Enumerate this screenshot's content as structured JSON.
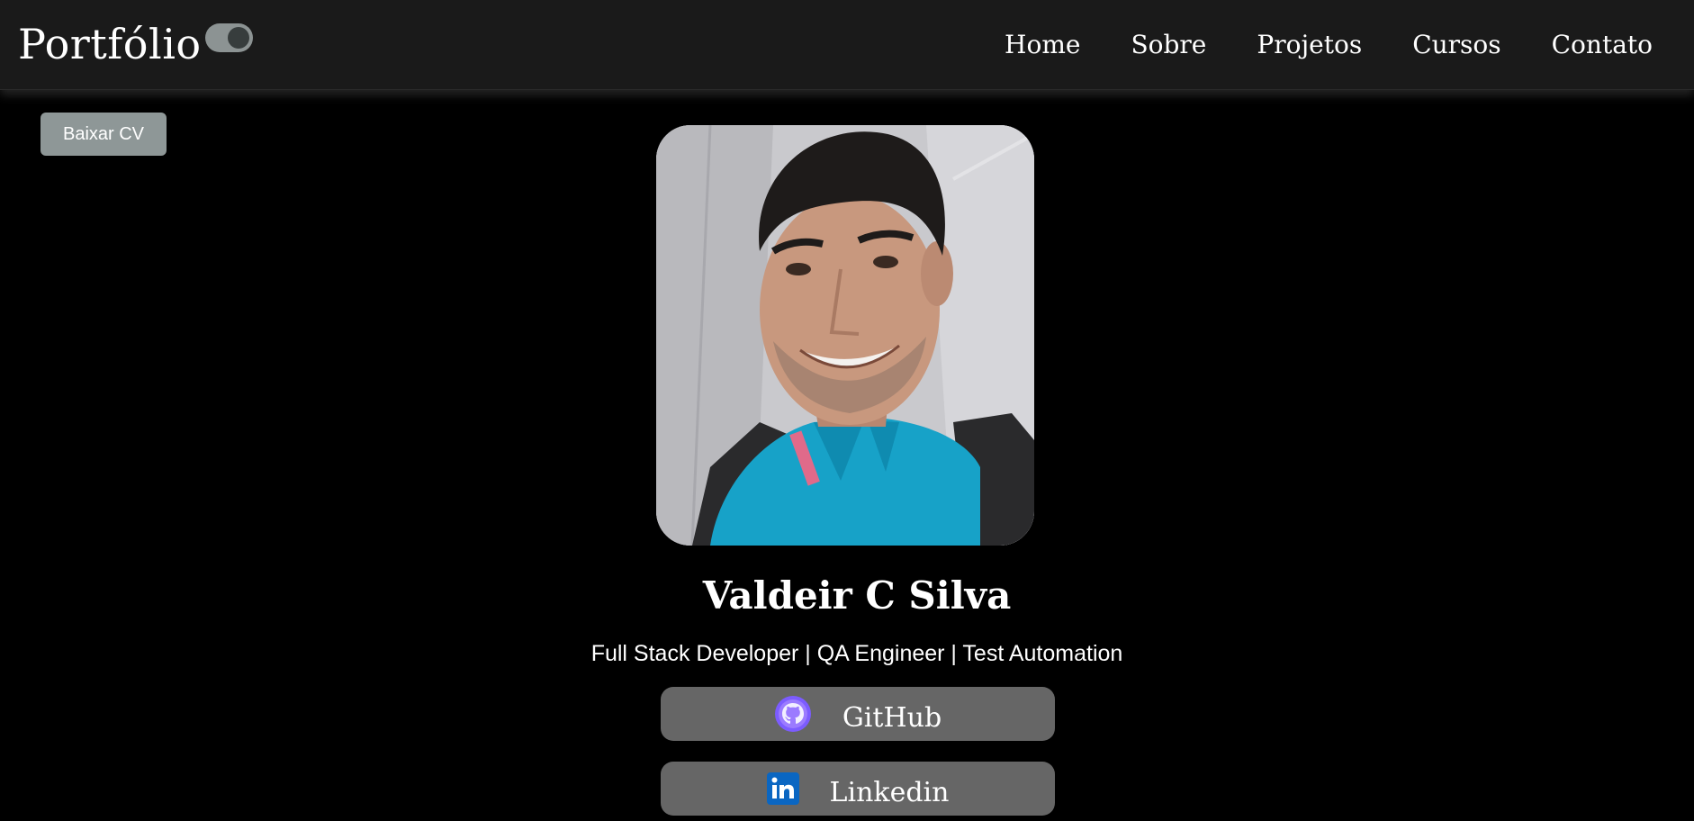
{
  "navbar": {
    "brand": "Portfólio",
    "links": [
      "Home",
      "Sobre",
      "Projetos",
      "Cursos",
      "Contato"
    ]
  },
  "theme_toggle": {
    "state": "on"
  },
  "download_cv": {
    "label": "Baixar CV"
  },
  "profile": {
    "name": "Valdeir C Silva",
    "tagline": "Full Stack Developer | QA Engineer | Test Automation"
  },
  "social": {
    "github_label": "GitHub",
    "linkedin_label": "Linkedin"
  },
  "colors": {
    "navbar_bg": "#1a1a1a",
    "page_bg": "#000000",
    "button_gray": "#8e9797",
    "social_bg": "#666666",
    "github_purple": "#7c5cff",
    "linkedin_blue": "#0a66c2"
  },
  "icons": [
    "github-icon",
    "linkedin-icon",
    "toggle-switch"
  ]
}
